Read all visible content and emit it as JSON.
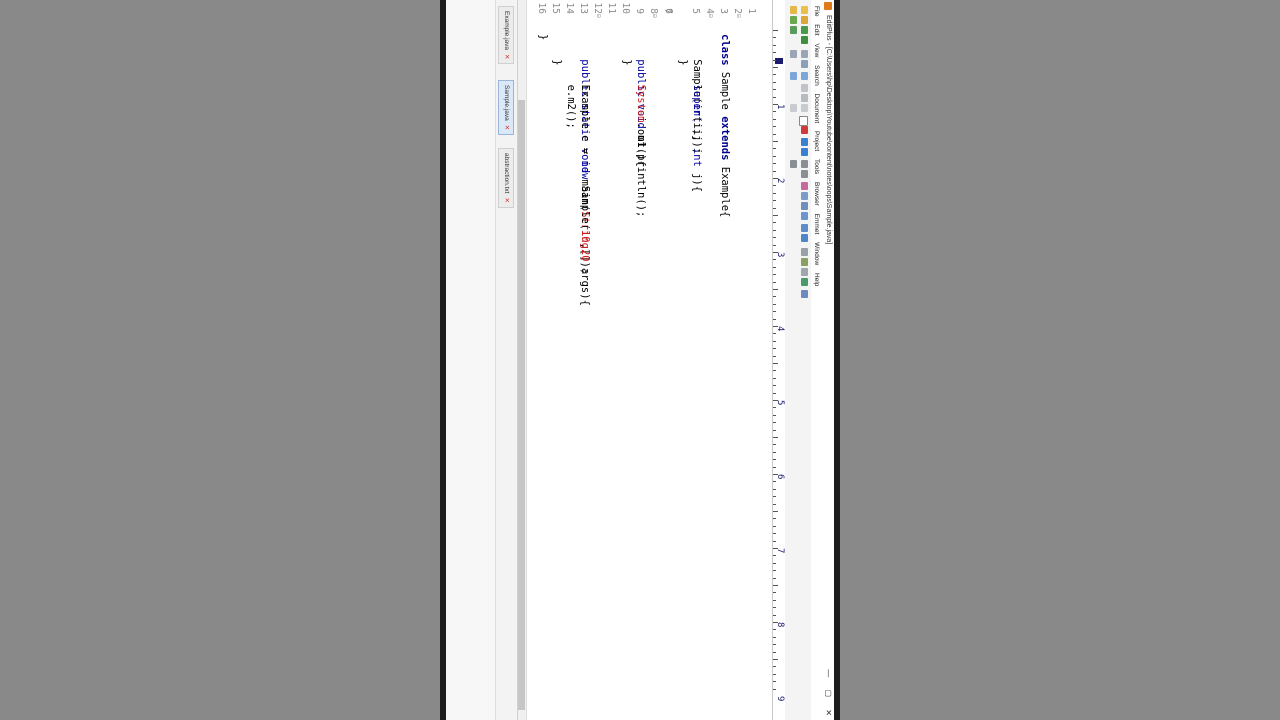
{
  "window": {
    "title": "EditPlus - [C:\\Users\\hp\\Desktop\\Youtube\\content\\notes\\oops\\Sample.java]",
    "controls": [
      "—",
      "▢",
      "✕"
    ]
  },
  "menu": [
    "File",
    "Edit",
    "View",
    "Search",
    "Document",
    "Project",
    "Tools",
    "Browser",
    "Emmet",
    "Window",
    "Help"
  ],
  "ruler": {
    "numbers": [
      "1",
      "2",
      "3",
      "4",
      "5",
      "6",
      "7",
      "8",
      "9"
    ]
  },
  "editor": {
    "lines": [
      {
        "n": "1",
        "fold": "⊟"
      },
      {
        "n": "2",
        "fold": ""
      },
      {
        "n": "3",
        "fold": "⊟"
      },
      {
        "n": "4",
        "fold": ""
      },
      {
        "n": "5",
        "fold": ""
      },
      {
        "n": "6",
        "fold": ""
      },
      {
        "n": "7",
        "fold": "⊟"
      },
      {
        "n": "8",
        "fold": ""
      },
      {
        "n": "9",
        "fold": ""
      },
      {
        "n": "10",
        "fold": ""
      },
      {
        "n": "11",
        "fold": "⊟"
      },
      {
        "n": "12",
        "fold": ""
      },
      {
        "n": "13",
        "fold": ""
      },
      {
        "n": "14",
        "fold": ""
      },
      {
        "n": "15",
        "fold": ""
      },
      {
        "n": "16",
        "fold": ""
      }
    ],
    "tokens": {
      "l1_class": "class",
      "l1_name": " Sample ",
      "l1_extends": "extends",
      "l1_rest": " Example{",
      "l3_a": "    Sample(",
      "l3_int1": "int",
      "l3_b": " i, ",
      "l3_int2": "int",
      "l3_c": " j){",
      "l4_indent": "        ",
      "l4_super": "super",
      "l4_rest": "(i,j);",
      "l5": "    }",
      "l7_indent": "    ",
      "l7_public": "public",
      "l7_sp": " ",
      "l7_void": "void",
      "l7_rest": " m1(){",
      "l8_indent": "        ",
      "l8_system": "System",
      "l8_rest": ".out.println();",
      "l9": "    }",
      "l11_indent": "    ",
      "l11_public": "public",
      "l11_sp1": " ",
      "l11_static": "static",
      "l11_sp2": " ",
      "l11_void": "void",
      "l11_a": " main(",
      "l11_string": "String",
      "l11_b": "[] args){",
      "l12_a": "        Example e = ",
      "l12_new": "new",
      "l12_b": " Sample(",
      "l12_n1": "10",
      "l12_c": ",",
      "l12_n2": "20",
      "l12_d": ");",
      "l13": "        e.m2();",
      "l14": "    }",
      "l15": "}"
    }
  },
  "tabs": [
    {
      "label": "Example.java",
      "close": "✕"
    },
    {
      "label": "Sample.java",
      "close": "✕"
    },
    {
      "label": "abstraction.txt",
      "close": "✕"
    }
  ]
}
